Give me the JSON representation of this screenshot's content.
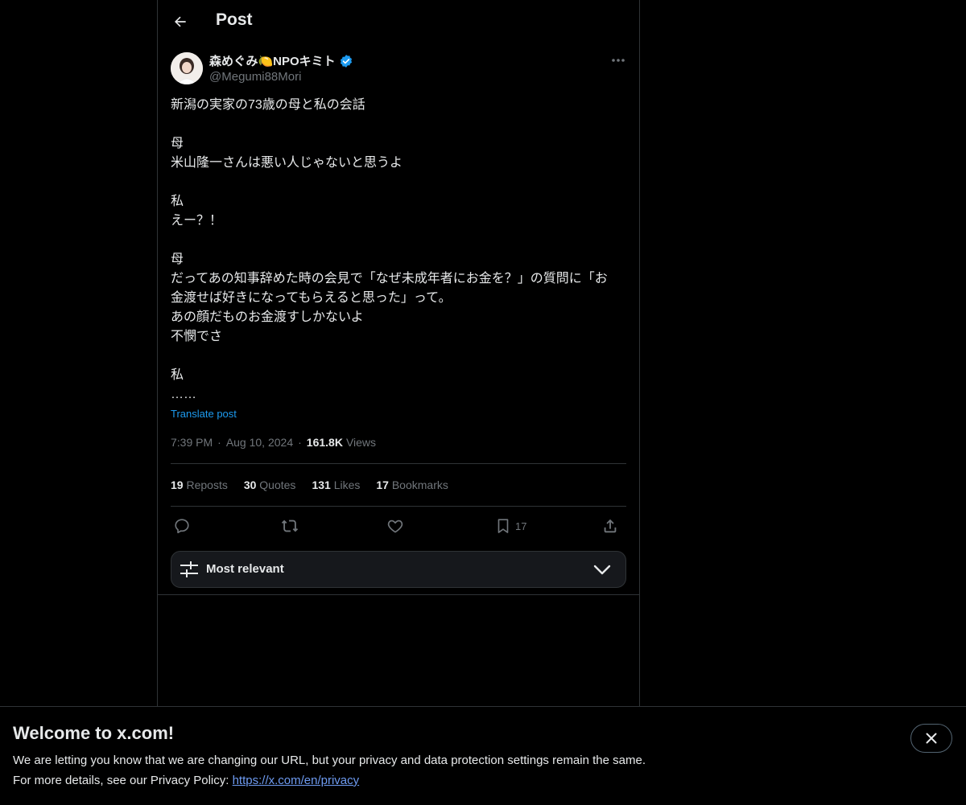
{
  "header": {
    "title": "Post"
  },
  "author": {
    "name": "森めぐみ🍋NPOキミト",
    "handle": "@Megumi88Mori",
    "verified": true,
    "verified_color": "#1d9bf0"
  },
  "post": {
    "lines": [
      "新潟の実家の73歳の母と私の会話",
      "",
      "母",
      "米山隆一さんは悪い人じゃないと思うよ",
      "",
      "私",
      "えー？！",
      "",
      "母",
      "だってあの知事辞めた時の会見で「なぜ未成年者にお金を？」の質問に「お",
      "金渡せば好きになってもらえると思った」って。",
      "あの顔だものお金渡すしかないよ",
      "不憫でさ",
      "",
      "私",
      "……"
    ],
    "translate_label": "Translate post",
    "time": "7:39 PM",
    "separator": "·",
    "date": "Aug 10, 2024",
    "views_count": "161.8K",
    "views_label": "Views"
  },
  "stats": {
    "reposts_count": "19",
    "reposts_label": "Reposts",
    "quotes_count": "30",
    "quotes_label": "Quotes",
    "likes_count": "131",
    "likes_label": "Likes",
    "bookmarks_count": "17",
    "bookmarks_label": "Bookmarks"
  },
  "actions": {
    "reply_icon": "reply-icon",
    "repost_icon": "repost-icon",
    "like_icon": "heart-icon",
    "bookmark_icon": "bookmark-icon",
    "bookmark_count": "17",
    "share_icon": "share-icon"
  },
  "sort": {
    "label": "Most relevant"
  },
  "banner": {
    "title": "Welcome to x.com!",
    "text1": "We are letting you know that we are changing our URL, but your privacy and data protection settings remain the same.",
    "text2_prefix": "For more details, see our Privacy Policy: ",
    "link": "https://x.com/en/privacy"
  },
  "colors": {
    "background": "#000000",
    "accent": "#1d9bf0",
    "muted": "#71767b",
    "border": "#2f3336",
    "link": "#6e9bf1"
  }
}
